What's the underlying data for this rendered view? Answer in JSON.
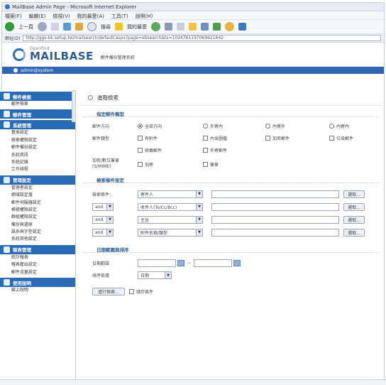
{
  "window": {
    "title": "MailBase Admin Page - Microsoft Internet Explorer"
  },
  "menu": [
    "檔案(F)",
    "編輯(E)",
    "檢視(V)",
    "我的最愛(A)",
    "工具(T)",
    "說明(H)"
  ],
  "toolbar": {
    "back": "上一頁",
    "search": "搜尋",
    "favorites": "我的最愛"
  },
  "address": {
    "label": "網址(D)",
    "url": "http://ggs-bk.setup.tw/mailsearch/default.aspx?page=ebsearch&ts=1024761197069621642"
  },
  "logo": {
    "sub": "Openfind",
    "brand": "MAILBASE",
    "tag": "郵件備份管理系統"
  },
  "user": {
    "name": "admin@system"
  },
  "sidebar": {
    "sections": [
      {
        "title": "郵件檢索",
        "items": [
          "郵件檢索"
        ]
      },
      {
        "title": "郵件管理",
        "items": []
      },
      {
        "title": "系統管理",
        "items": [
          "基本設定",
          "檢索權限設定",
          "郵件備份設定",
          "系統資訊",
          "系統記錄",
          "工作排程"
        ]
      },
      {
        "title": "管理設定",
        "items": [
          "管理者設定",
          "網域設定值",
          "郵件伺服器設定",
          "帳號權限設定",
          "群組權限設定",
          "備份與還原",
          "語系與字型設定",
          "系統其他設定"
        ]
      },
      {
        "title": "報表管理",
        "items": [
          "統計報表",
          "報表產出設定",
          "郵件流量設定"
        ]
      },
      {
        "title": "使用說明",
        "items": [
          "線上說明"
        ]
      }
    ]
  },
  "main": {
    "page_title": "進階檢索",
    "sec1": "指定郵件類型",
    "dir_label": "郵件方向",
    "dir_opts": [
      "全部方向",
      "外寄內",
      "內寄外",
      "內寄內"
    ],
    "type_label": "郵件類型",
    "type_opts": [
      "有附件",
      "內含圖檔",
      "加密郵件",
      "垃圾郵件",
      "病毒郵件",
      "外寄郵件"
    ],
    "charset_label": "加密/數位簽章(S/MIME)",
    "charset_opts": [
      "加密",
      "簽章"
    ],
    "sec2": "檢索條件設定",
    "cond_label": "檢索條件：",
    "conds": [
      {
        "logic": "",
        "field": "寄件人",
        "btn": "選取..."
      },
      {
        "logic": "and",
        "field": "收件人(To/Cc/Bcc)",
        "btn": "選取..."
      },
      {
        "logic": "and",
        "field": "主旨",
        "btn": "選取..."
      },
      {
        "logic": "and",
        "field": "附件名稱/類型",
        "btn": "選取..."
      }
    ],
    "sec3": "日期範圍與排序",
    "date_label": "日期範圍",
    "date_sep": "~",
    "sort_label": "排序依據",
    "sort_value": "日期",
    "search_btn": "進行檢索...",
    "save_label": "儲存條件"
  },
  "colors": {
    "accent": "#2a6bb8",
    "header_text": "#2c5e99"
  }
}
